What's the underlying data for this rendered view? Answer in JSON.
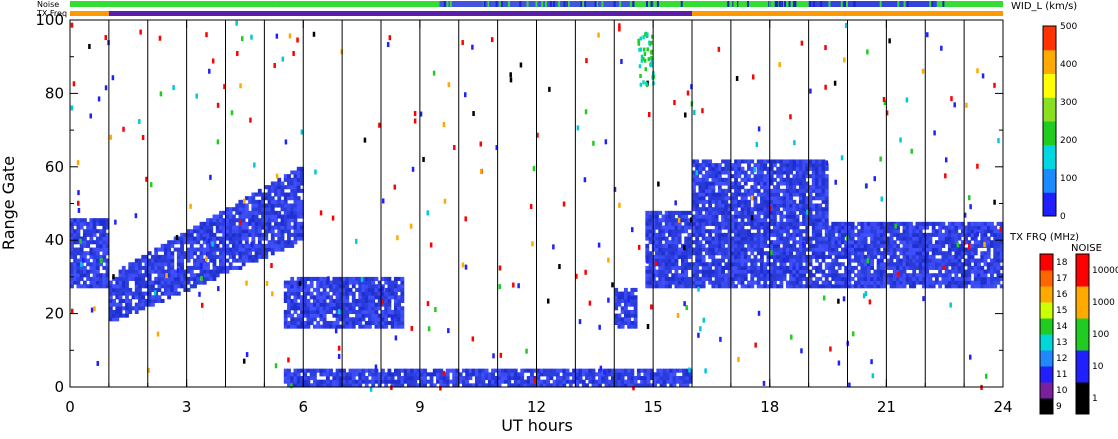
{
  "chart_data": {
    "type": "heatmap",
    "title": "",
    "xlabel": "UT hours",
    "ylabel": "Range Gate",
    "xlim": [
      0,
      24
    ],
    "ylim": [
      0,
      100
    ],
    "x_ticks": [
      0,
      3,
      6,
      9,
      12,
      15,
      18,
      21,
      24
    ],
    "y_ticks": [
      0,
      20,
      40,
      60,
      80,
      100
    ],
    "vertical_scan_lines_hours": [
      1,
      2,
      3,
      4,
      5,
      6,
      7,
      8,
      9,
      10,
      11,
      12,
      13,
      14,
      15,
      16,
      17,
      18,
      19,
      20,
      21,
      22,
      23
    ],
    "top_bars": {
      "noise_label": "Noise",
      "txfreq_label": "TX Freq",
      "txfreq_segments": [
        {
          "start": 0,
          "end": 1,
          "color": "#ff9900"
        },
        {
          "start": 1,
          "end": 16,
          "color": "#5a1ea8"
        },
        {
          "start": 16,
          "end": 24,
          "color": "#ff9900"
        }
      ],
      "noise_segments": [
        {
          "start": 0,
          "end": 5.3,
          "color": "#33dd33"
        },
        {
          "start": 5.3,
          "end": 9.5,
          "color": "#33dd33"
        },
        {
          "start": 9.5,
          "end": 14.5,
          "color": "#4455dd"
        },
        {
          "start": 14.5,
          "end": 16.0,
          "color": "#33dd33"
        },
        {
          "start": 16.0,
          "end": 19.0,
          "color": "#33dd33"
        },
        {
          "start": 19.0,
          "end": 22.3,
          "color": "#3344dd"
        },
        {
          "start": 22.3,
          "end": 24,
          "color": "#33dd33"
        }
      ]
    },
    "echo_regions": [
      {
        "name": "main band A",
        "t_start": 0,
        "t_end": 1,
        "g_low": 27,
        "g_high": 46,
        "color": "#2b3fe0"
      },
      {
        "name": "rising band",
        "t_start": 1,
        "t_end": 6,
        "g_low_start": 18,
        "g_low_end": 40,
        "g_high_start": 30,
        "g_high_end": 60,
        "color": "#2b3fe0"
      },
      {
        "name": "patch 6-8.5h",
        "t_start": 5.5,
        "t_end": 8.6,
        "g_low": 16,
        "g_high": 30,
        "color": "#2b3fe0"
      },
      {
        "name": "near-range 6-16h",
        "t_start": 5.5,
        "t_end": 16,
        "g_low": 0,
        "g_high": 5,
        "color": "#2b3fe0"
      },
      {
        "name": "blob 14.5h",
        "t_start": 14.0,
        "t_end": 14.6,
        "g_low": 16,
        "g_high": 27,
        "color": "#2b3fe0"
      },
      {
        "name": "rise 15h",
        "t_start": 14.8,
        "t_end": 16,
        "g_low": 27,
        "g_high": 48,
        "color": "#2b3fe0"
      },
      {
        "name": "band 16-24h",
        "t_start": 16,
        "t_end": 24,
        "g_low": 27,
        "g_high": 45,
        "color": "#2b3fe0"
      },
      {
        "name": "upper 16-19h",
        "t_start": 16,
        "t_end": 19.5,
        "g_low": 44,
        "g_high": 62,
        "color": "#2b3fe0"
      }
    ],
    "colorbars": [
      {
        "title": "WID_L (km/s)",
        "ticks": [
          "0",
          "100",
          "200",
          "300",
          "400",
          "500"
        ],
        "colors": [
          "#2020ff",
          "#1a8cff",
          "#00d7e0",
          "#20cc20",
          "#88e020",
          "#ffff00",
          "#ffaa00",
          "#ff3300"
        ]
      },
      {
        "title": "TX FRQ (MHz)",
        "ticks": [
          "9",
          "10",
          "11",
          "12",
          "13",
          "14",
          "15",
          "16",
          "17",
          "18"
        ],
        "colors": [
          "#000000",
          "#7a1fa0",
          "#2020ff",
          "#2288ff",
          "#00d8d8",
          "#20cc20",
          "#ccff00",
          "#ffaa00",
          "#ff6600",
          "#ff0000"
        ]
      },
      {
        "title": "NOISE",
        "ticks": [
          "1",
          "10",
          "100",
          "1000",
          "10000"
        ],
        "colors": [
          "#000000",
          "#2020ff",
          "#20cc20",
          "#ffaa00",
          "#ff0000"
        ]
      }
    ]
  }
}
